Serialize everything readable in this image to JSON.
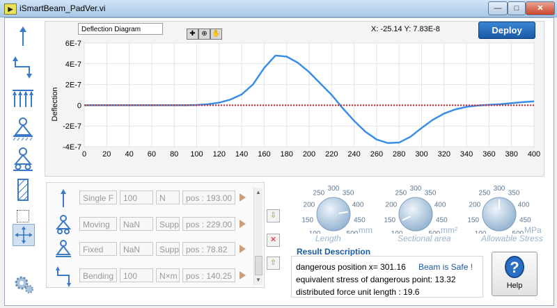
{
  "window": {
    "title": "iSmartBeam_PadVer.vi",
    "app_icon": "▶",
    "minimize": "—",
    "maximize": "□",
    "close": "✕"
  },
  "toolbar": [
    "force-arrow-icon",
    "bending-moment-icon",
    "distributed-force-icon",
    "fixed-support-icon",
    "moving-support-icon",
    "hatched-beam-icon",
    "select-move-icon",
    "gear-icon"
  ],
  "chart": {
    "label": "Deflection Diagram",
    "cursor_x": "-25.14",
    "cursor_y": "7.83E-8",
    "cursor_text": "X:  -25.14  Y:  7.83E-8",
    "deploy": "Deploy"
  },
  "chart_data": {
    "type": "line",
    "ylabel": "Deflection",
    "xlim": [
      0,
      400
    ],
    "ylim": [
      -4e-07,
      6e-07
    ],
    "x_ticks": [
      "0",
      "20",
      "40",
      "60",
      "80",
      "100",
      "120",
      "140",
      "160",
      "180",
      "200",
      "220",
      "240",
      "260",
      "280",
      "300",
      "320",
      "340",
      "360",
      "380",
      "400"
    ],
    "y_ticks": [
      "6E-7",
      "4E-7",
      "2E-7",
      "0",
      "-2E-7",
      "-4E-7"
    ],
    "grid": true,
    "series": [
      {
        "color": "#3a8ee6",
        "x": [
          0,
          60,
          80,
          90,
          100,
          110,
          120,
          130,
          140,
          150,
          160,
          170,
          180,
          190,
          200,
          210,
          220,
          230,
          240,
          250,
          260,
          270,
          280,
          290,
          300,
          310,
          320,
          330,
          340,
          350,
          360,
          370,
          380,
          390,
          400
        ],
        "y": [
          0,
          0,
          0,
          5e-10,
          3e-09,
          1e-08,
          2.5e-08,
          5.5e-08,
          1.05e-07,
          2e-07,
          3.6e-07,
          4.8e-07,
          4.7e-07,
          4.1e-07,
          3.2e-07,
          2.1e-07,
          1e-07,
          -3e-08,
          -1.5e-07,
          -2.55e-07,
          -3.3e-07,
          -3.65e-07,
          -3.6e-07,
          -3.05e-07,
          -2.2e-07,
          -1.4e-07,
          -8e-08,
          -4e-08,
          -1.5e-08,
          -2e-09,
          4e-09,
          1e-08,
          2e-08,
          3e-08,
          3.8e-08
        ]
      },
      {
        "color": "#d42020",
        "style": "dotted",
        "x": [
          0,
          400
        ],
        "y": [
          0,
          0
        ]
      }
    ]
  },
  "loads": [
    {
      "icon": "force-arrow-icon",
      "type": "Single F",
      "value": "100",
      "unit": "N",
      "pos": "pos : 193.00"
    },
    {
      "icon": "moving-support-icon",
      "type": "Moving",
      "value": "NaN",
      "unit": "Supp",
      "pos": "pos : 229.00"
    },
    {
      "icon": "fixed-support-icon",
      "type": "Fixed",
      "value": "NaN",
      "unit": "Supp",
      "pos": "pos : 78.82"
    },
    {
      "icon": "bending-moment-icon",
      "type": "Bending",
      "value": "100",
      "unit": "N×m",
      "pos": "pos : 140.25"
    }
  ],
  "side_buttons": [
    "⇩",
    "✕",
    "⇧"
  ],
  "knobs": [
    {
      "name": "Length",
      "unit": "mm",
      "labels": [
        "100",
        "150",
        "200",
        "250",
        "300",
        "350",
        "400",
        "450",
        "500"
      ],
      "value": 420
    },
    {
      "name": "Sectional area",
      "unit": "mm²",
      "labels": [
        "100",
        "150",
        "200",
        "250",
        "300",
        "350",
        "400",
        "450",
        "500"
      ],
      "value": 130
    },
    {
      "name": "Allowable Stress",
      "unit": "MPa",
      "labels": [
        "100",
        "150",
        "200",
        "250",
        "300",
        "350",
        "400",
        "450",
        "500"
      ],
      "value": 300
    }
  ],
  "result": {
    "title": "Result Description",
    "line1": "dangerous position x= 301.16",
    "status": "Beam is Safe !",
    "line2": "equivalent stress of dangerous point: 13.32",
    "line3": "distributed force unit length :   19.6"
  },
  "help": {
    "label": "Help",
    "icon": "?"
  }
}
